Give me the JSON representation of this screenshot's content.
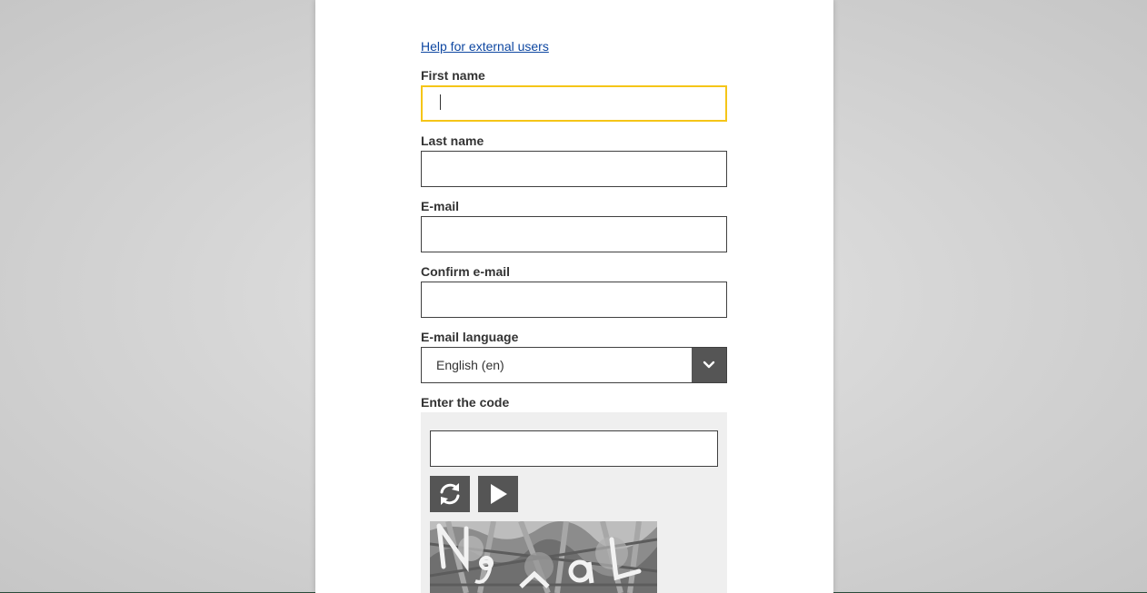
{
  "help_link": "Help for external users",
  "form": {
    "first_name_label": "First name",
    "last_name_label": "Last name",
    "email_label": "E-mail",
    "confirm_email_label": "Confirm e-mail",
    "email_language_label": "E-mail language",
    "email_language_value": "English (en)",
    "code_label": "Enter the code"
  },
  "captcha": {
    "refresh_icon": "refresh-icon",
    "play_icon": "play-icon",
    "image_text": "N9 aL"
  },
  "colors": {
    "focus_border": "#f5c518",
    "link": "#0e47a1",
    "button_bg": "#555555"
  }
}
